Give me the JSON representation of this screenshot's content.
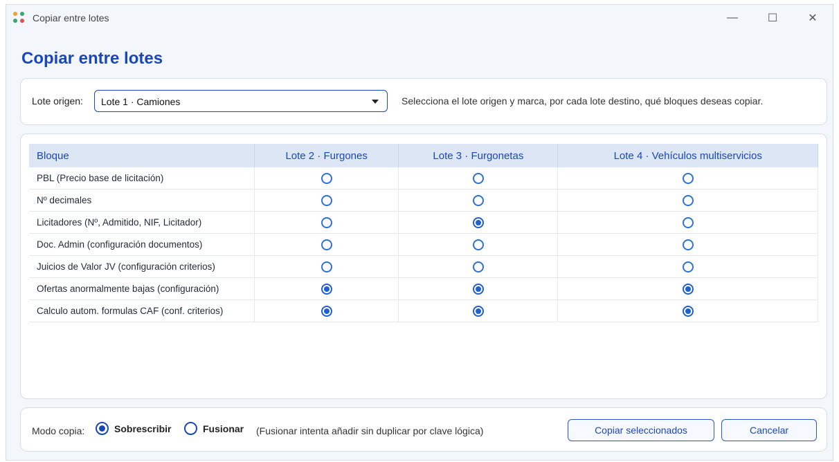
{
  "window": {
    "title": "Copiar entre lotes",
    "min": "—",
    "max": "☐",
    "close": "✕"
  },
  "heading": "Copiar entre lotes",
  "source": {
    "label": "Lote origen:",
    "selected": "Lote 1 · Camiones",
    "hint": "Selecciona el lote origen y marca, por cada lote destino, qué bloques deseas copiar."
  },
  "table": {
    "headers": [
      "Bloque",
      "Lote 2 · Furgones",
      "Lote 3 · Furgonetas",
      "Lote 4 · Vehículos multiservicios"
    ],
    "rows": [
      {
        "block": "PBL (Precio base de licitación)",
        "sel": [
          false,
          false,
          false
        ]
      },
      {
        "block": "Nº decimales",
        "sel": [
          false,
          false,
          false
        ]
      },
      {
        "block": "Licitadores (Nº, Admitido, NIF, Licitador)",
        "sel": [
          false,
          true,
          false
        ]
      },
      {
        "block": "Doc. Admin (configuración documentos)",
        "sel": [
          false,
          false,
          false
        ]
      },
      {
        "block": "Juicios de Valor JV (configuración criterios)",
        "sel": [
          false,
          false,
          false
        ]
      },
      {
        "block": "Ofertas anormalmente bajas (configuración)",
        "sel": [
          true,
          true,
          true
        ]
      },
      {
        "block": "Calculo autom. formulas CAF (conf. criterios)",
        "sel": [
          true,
          true,
          true
        ]
      }
    ]
  },
  "mode": {
    "label": "Modo copia:",
    "overwrite": "Sobrescribir",
    "merge": "Fusionar",
    "selected": "overwrite",
    "note": "(Fusionar intenta añadir sin duplicar por clave lógica)"
  },
  "buttons": {
    "copy": "Copiar seleccionados",
    "cancel": "Cancelar"
  },
  "colors": {
    "accent": "#1a47b8",
    "header_bg": "#dce6f5"
  }
}
